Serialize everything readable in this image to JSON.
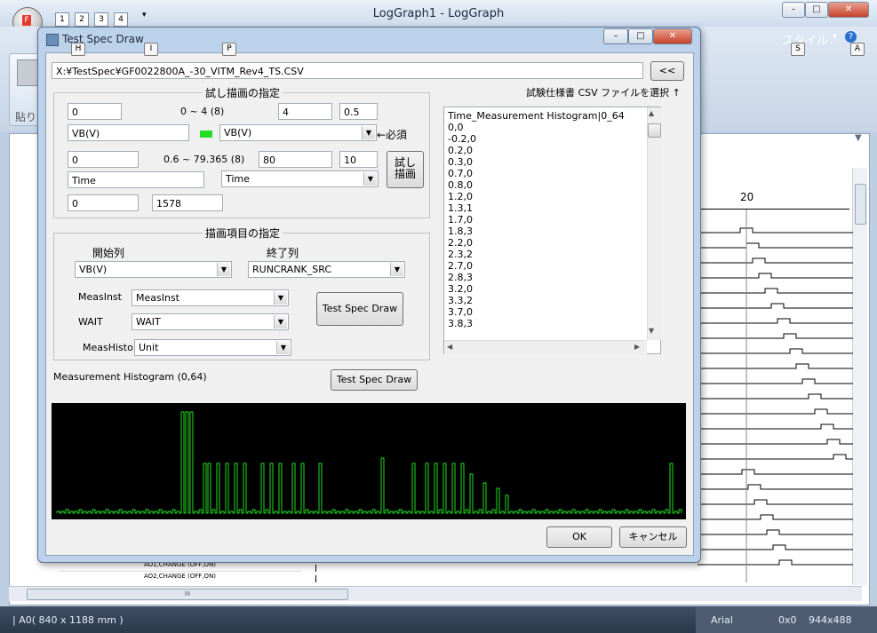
{
  "app": {
    "title": "LogGraph1 - LogGraph",
    "orb_letter": "F",
    "quick_access": [
      "1",
      "2",
      "3",
      "4"
    ],
    "ribbon_keytips": [
      "H",
      "I",
      "P"
    ],
    "right_keytips": [
      "S",
      "A"
    ],
    "style_label": "スタイル",
    "paste_label": "貼り",
    "ruler_number": "20",
    "help_icon": "question-icon",
    "trace_labels": [
      "AO1,CHANGE (OFF,ON)",
      "AO2,CHANGE (OFF,ON)"
    ],
    "hscroll_grip": "III",
    "status": {
      "paper": "A0( 840 x 1188 mm )",
      "font": "Arial",
      "coords": "0x0",
      "size": "944x488"
    }
  },
  "dialog": {
    "title": "Test Spec Draw",
    "file_path": "X:¥TestSpec¥GF0022800A_-30_VITM_Rev4_TS.CSV",
    "collapse_button": "<<",
    "select_csv_label": "試験仕様書 CSV ファイルを選択 ↑",
    "trial_group": {
      "title": "試し描画の指定",
      "y_min": "0",
      "y_range_text": "0 ~ 4 (8)",
      "y_max": "4",
      "y_step": "0.5",
      "y_name": "VB(V)",
      "y_column": "VB(V)",
      "required_label": "←必須",
      "x_min": "0",
      "x_range_text": "0.6 ~ 79.365 (8)",
      "x_max": "80",
      "x_step": "10",
      "x_name": "Time",
      "x_column": "Time",
      "row_start": "0",
      "row_end": "1578",
      "draw_button_line1": "試し",
      "draw_button_line2": "描画",
      "color_indicator": "#22dd22"
    },
    "items_group": {
      "title": "描画項目の指定",
      "start_col_label": "開始列",
      "end_col_label": "終了列",
      "start_col": "VB(V)",
      "end_col": "RUNCRANK_SRC",
      "meas_inst_label": "MeasInst",
      "meas_inst": "MeasInst",
      "wait_label": "WAIT",
      "wait": "WAIT",
      "meas_histo_label": "MeasHisto",
      "meas_histo": "Unit",
      "test_spec_draw_button": "Test Spec Draw"
    },
    "histogram_label": "Measurement Histogram (0,64)",
    "histogram_draw_button": "Test Spec Draw",
    "ok_button": "OK",
    "cancel_button": "キャンセル",
    "csv_items": [
      "Time_Measurement Histogram|0_64",
      "0,0",
      "-0.2,0",
      "0.2,0",
      "0.3,0",
      "0.7,0",
      "0.8,0",
      "1.2,0",
      "1.3,1",
      "1.7,0",
      "1.8,3",
      "2.2,0",
      "2.3,2",
      "2.7,0",
      "2.8,3",
      "3.2,0",
      "3.3,2",
      "3.7,0",
      "3.8,3"
    ],
    "histogram_color": "#22dd22"
  }
}
